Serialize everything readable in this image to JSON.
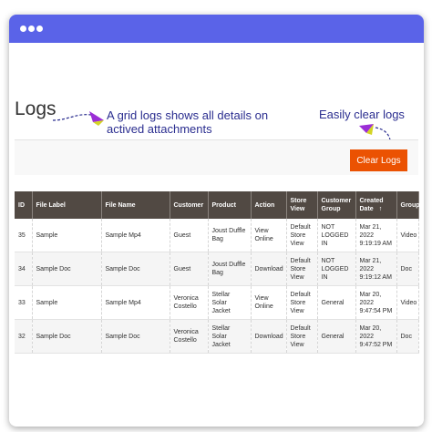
{
  "page": {
    "title": "Logs",
    "clear_button": "Clear Logs"
  },
  "annotations": {
    "grid_note": "A grid logs shows all details on actived attachments",
    "clear_note": "Easily clear logs"
  },
  "colors": {
    "titlebar": "#5a63e8",
    "accent_button": "#eb5202",
    "header_bg": "#514943",
    "link": "#1979c3",
    "annotation_text": "#2a2d8f",
    "annotation_arrow": "#9b2ed6"
  },
  "table": {
    "columns": [
      "ID",
      "File Label",
      "File Name",
      "Customer",
      "Product",
      "Action",
      "Store View",
      "Customer Group",
      "Created Date",
      "Group"
    ],
    "sort_indicator": "↑",
    "rows": [
      {
        "id": "35",
        "file_label": "Sample",
        "file_name": "Sample Mp4",
        "customer": "Guest",
        "product": "Joust Duffle Bag",
        "action": "View Online",
        "store_view": "Default Store View",
        "customer_group": "NOT LOGGED IN",
        "created_date": "Mar 21, 2022 9:19:19 AM",
        "group": "Video"
      },
      {
        "id": "34",
        "file_label": "Sample Doc",
        "file_name": "Sample Doc",
        "customer": "Guest",
        "product": "Joust Duffle Bag",
        "action": "Download",
        "store_view": "Default Store View",
        "customer_group": "NOT LOGGED IN",
        "created_date": "Mar 21, 2022 9:19:12 AM",
        "group": "Doc"
      },
      {
        "id": "33",
        "file_label": "Sample",
        "file_name": "Sample Mp4",
        "customer": "Veronica Costello",
        "product": "Stellar Solar Jacket",
        "action": "View Online",
        "store_view": "Default Store View",
        "customer_group": "General",
        "created_date": "Mar 20, 2022 9:47:54 PM",
        "group": "Video"
      },
      {
        "id": "32",
        "file_label": "Sample Doc",
        "file_name": "Sample Doc",
        "customer": "Veronica Costello",
        "product": "Stellar Solar Jacket",
        "action": "Download",
        "store_view": "Default Store View",
        "customer_group": "General",
        "created_date": "Mar 20, 2022 9:47:52 PM",
        "group": "Doc"
      }
    ]
  }
}
